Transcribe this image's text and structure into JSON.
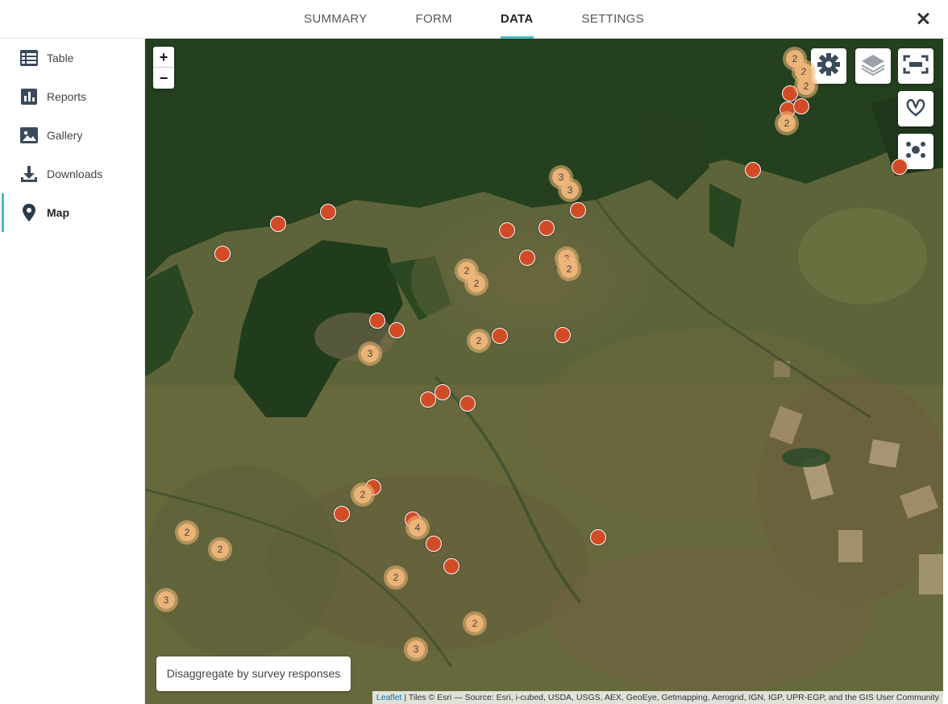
{
  "tabs": [
    {
      "label": "SUMMARY",
      "active": false
    },
    {
      "label": "FORM",
      "active": false
    },
    {
      "label": "DATA",
      "active": true
    },
    {
      "label": "SETTINGS",
      "active": false
    }
  ],
  "sidebar": {
    "items": [
      {
        "label": "Table",
        "icon": "table-icon"
      },
      {
        "label": "Reports",
        "icon": "bar-chart-icon"
      },
      {
        "label": "Gallery",
        "icon": "image-icon"
      },
      {
        "label": "Downloads",
        "icon": "download-icon"
      },
      {
        "label": "Map",
        "icon": "map-pin-icon",
        "active": true
      }
    ]
  },
  "map": {
    "zoom_in": "+",
    "zoom_out": "−",
    "disaggregate_label": "Disaggregate by survey responses",
    "attribution": {
      "link": "Leaflet",
      "text": " | Tiles © Esri — Source: Esri, i-cubed, USDA, USGS, AEX, GeoEye, Getmapping, Aerogrid, IGN, IGP, UPR-EGP, and the GIS User Community"
    },
    "clusters": [
      "2",
      "2",
      "2",
      "2",
      "3",
      "3",
      "3",
      "2",
      "2",
      "2",
      "3",
      "2",
      "4",
      "2",
      "2",
      "2",
      "3",
      "2",
      "3",
      "2"
    ]
  },
  "colors": {
    "accent": "#4fb8c6",
    "marker": "#d14c26",
    "cluster": "#eeb478"
  }
}
